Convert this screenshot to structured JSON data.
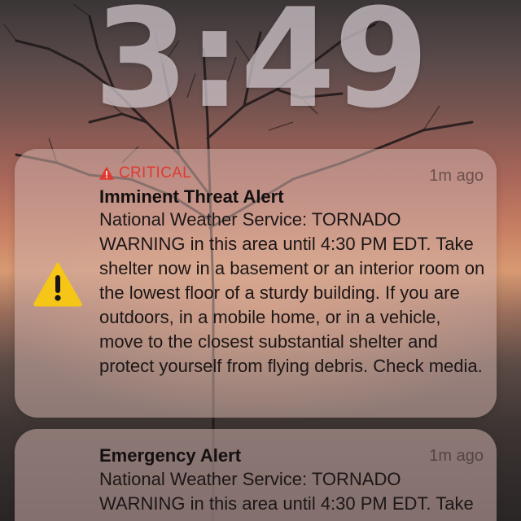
{
  "lock_screen": {
    "time": "3:49"
  },
  "notifications": [
    {
      "badge": "CRITICAL",
      "badge_color": "#e03a32",
      "icon": "warning-triangle-icon",
      "title": "Imminent Threat Alert",
      "time_ago": "1m ago",
      "body": "National Weather Service: TORNADO WARNING in this area until 4:30 PM EDT. Take shelter now in a basement or an interior room on the lowest floor of a sturdy building. If you are outdoors, in a mobile home, or in a vehicle, move to the closest substantial shelter and protect yourself from flying debris. Check media."
    },
    {
      "title": "Emergency Alert",
      "time_ago": "1m ago",
      "body": "National Weather Service: TORNADO WARNING in this area until 4:30 PM EDT. Take shelter now in a basement"
    }
  ],
  "colors": {
    "warning_yellow": "#f5c518",
    "notification_bg": "rgba(205,175,170,0.55)"
  }
}
